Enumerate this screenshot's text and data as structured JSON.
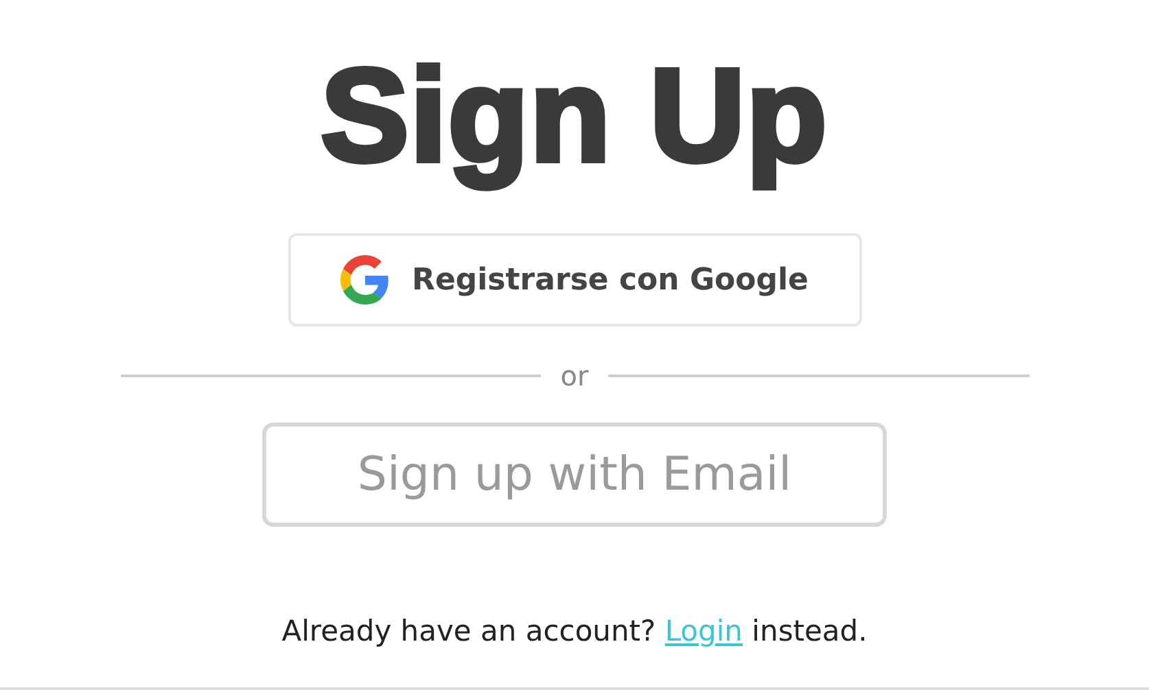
{
  "title": "Sign Up",
  "google_button": {
    "label": "Registrarse con Google"
  },
  "divider": {
    "label": "or"
  },
  "email_button": {
    "label": "Sign up with Email"
  },
  "footer": {
    "before": "Already have an account? ",
    "link": "Login",
    "after": " instead."
  }
}
